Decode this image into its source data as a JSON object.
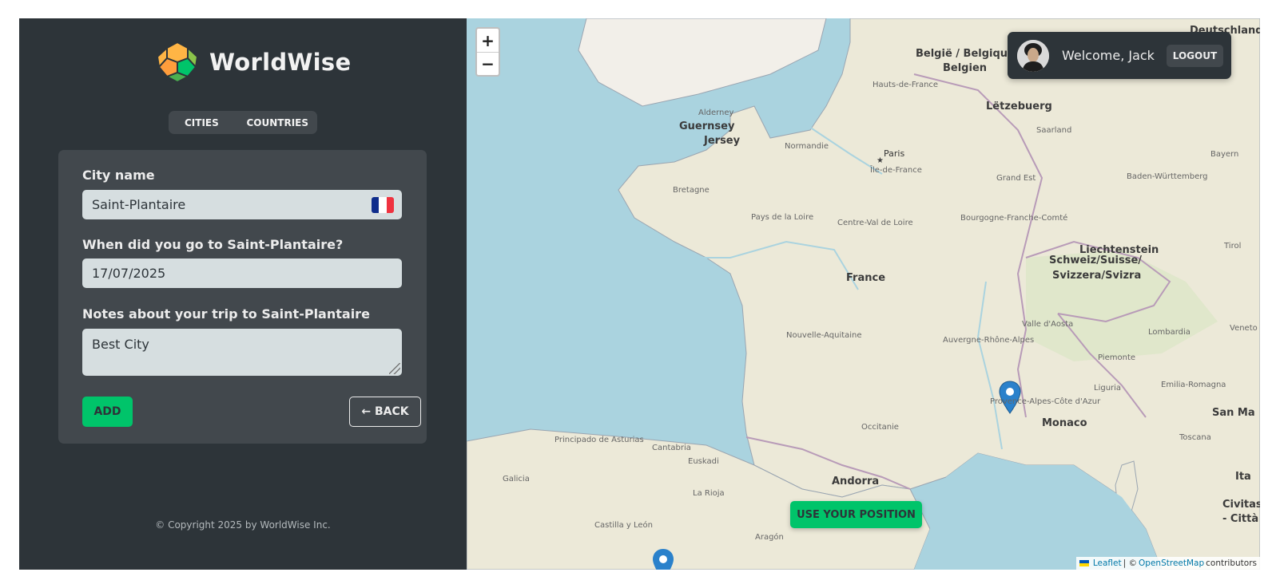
{
  "app": {
    "name": "WorldWise"
  },
  "tabs": [
    {
      "label": "Cities"
    },
    {
      "label": "Countries"
    }
  ],
  "form": {
    "city_label": "City name",
    "city_value": "Saint-Plantaire",
    "flag_icon": "flag-france-icon",
    "date_label": "When did you go to Saint-Plantaire?",
    "date_value": "17/07/2025",
    "notes_label": "Notes about your trip to Saint-Plantaire",
    "notes_value": "Best City",
    "add_label": "ADD",
    "back_label": "← BACK"
  },
  "footer": {
    "copyright": "© Copyright 2025 by WorldWise Inc."
  },
  "map": {
    "zoom_in": "+",
    "zoom_out": "−",
    "user": {
      "welcome": "Welcome, Jack",
      "logout": "LOGOUT"
    },
    "use_position": "USE YOUR POSITION",
    "attribution": {
      "leaflet": "Leaflet",
      "separator": "| ©",
      "osm": "OpenStreetMap",
      "contributors": "contributors"
    },
    "labels": {
      "belgium": "België / Belgique /",
      "belgien": "Belgien",
      "deutschland": "Deutschland",
      "luxembourg": "Lëtzebuerg",
      "guernsey": "Guernsey",
      "jersey": "Jersey",
      "paris": "Paris",
      "france": "France",
      "liechtenstein": "Liechtenstein",
      "swiss1": "Schweiz/Suisse/",
      "swiss2": "Svizzera/Svizra",
      "monaco": "Monaco",
      "andorra": "Andorra",
      "civitas1": "Civitas Va",
      "civitas2": "- Città del",
      "sanma": "San Ma",
      "ita": "Ita",
      "normandie": "Normandie",
      "bretagne": "Bretagne",
      "paysdelaloire": "Pays de la Loire",
      "centre": "Centre-Val de Loire",
      "nouvelle": "Nouvelle-Aquitaine",
      "occitanie": "Occitanie",
      "auvergne": "Auvergne-Rhône-Alpes",
      "bourgogne": "Bourgogne-Franche-Comté",
      "grandest": "Grand Est",
      "hautsdefrance": "Hauts-de-France",
      "iledefrance": "Île-de-France",
      "provence": "Provence-Alpes-Côte d'Azur",
      "bayern": "Bayern",
      "badenw": "Baden-Württemberg",
      "saarland": "Saarland",
      "principado": "Principado de Asturias",
      "cantabria": "Cantabria",
      "euskadi": "Euskadi",
      "galicia": "Galicia",
      "larioja": "La Rioja",
      "castilla": "Castilla y León",
      "aragon": "Aragón",
      "piemonte": "Piemonte",
      "lombardia": "Lombardia",
      "liguria": "Liguria",
      "emilia": "Emilia-Romagna",
      "toscana": "Toscana",
      "valledaosta": "Valle d'Aosta",
      "veneto": "Veneto",
      "tirol": "Tirol",
      "alderney": "Alderney"
    }
  }
}
